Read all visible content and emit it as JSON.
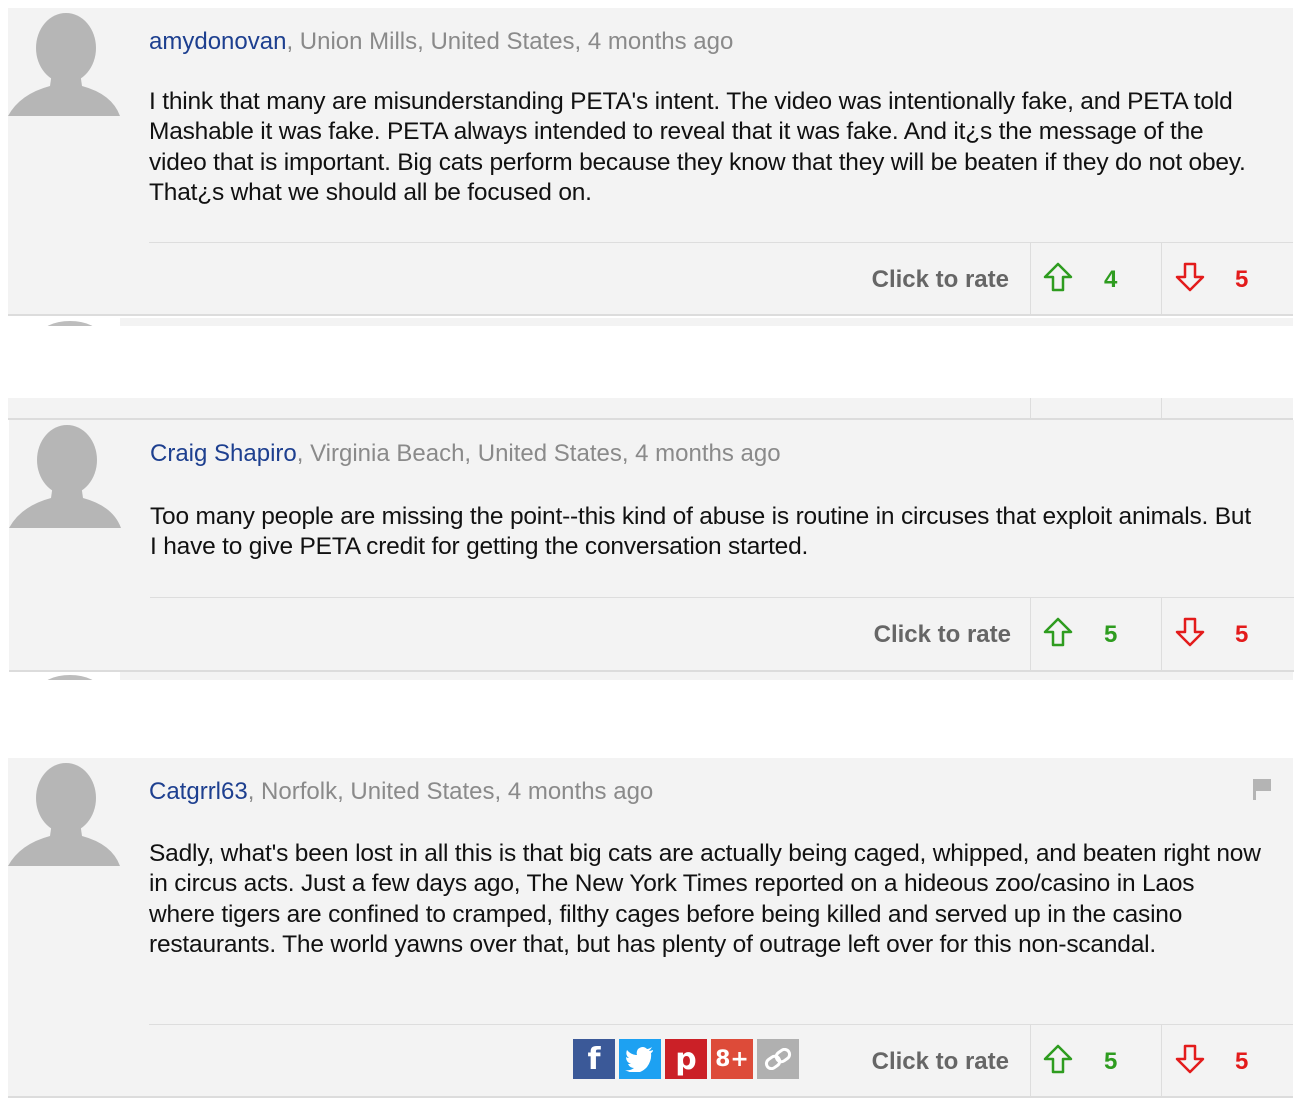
{
  "comments": [
    {
      "author": "amydonovan",
      "location_time": ", Union Mills, United States, 4 months ago",
      "text": "I think that many are misunderstanding PETA's intent. The video was intentionally fake, and PETA told Mashable it was fake. PETA always intended to reveal that it was fake. And it¿s the message of the video that is important. Big cats perform because they know that they will be beaten if they do not obey. That¿s what we should all be focused on.",
      "rate_label": "Click to rate",
      "up_votes": "4",
      "down_votes": "5"
    },
    {
      "author": "Craig Shapiro",
      "location_time": ", Virginia Beach, United States, 4 months ago",
      "text": "Too many people are missing the point--this kind of abuse is routine in circuses that exploit animals. But I have to give PETA credit for getting the conversation started.",
      "rate_label": "Click to rate",
      "up_votes": "5",
      "down_votes": "5"
    },
    {
      "author": "Catgrrl63",
      "location_time": ", Norfolk, United States, 4 months ago",
      "text": "Sadly, what's been lost in all this is that big cats are actually being caged, whipped, and beaten right now in circus acts. Just a few days ago, The New York Times reported on a hideous zoo/casino in Laos where tigers are confined to cramped, filthy cages before being killed and served up in the casino restaurants. The world yawns over that, but has plenty of outrage left over for this non-scandal.",
      "rate_label": "Click to rate",
      "up_votes": "5",
      "down_votes": "5"
    }
  ],
  "share": [
    {
      "icon": "facebook-icon",
      "glyph": "f",
      "color": "#3b5998"
    },
    {
      "icon": "twitter-icon",
      "glyph": "t",
      "color": "#1da1f2"
    },
    {
      "icon": "pinterest-icon",
      "glyph": "p",
      "color": "#cb2027"
    },
    {
      "icon": "google-plus-icon",
      "glyph": "8+",
      "color": "#dd4b39"
    },
    {
      "icon": "link-icon",
      "glyph": "∞",
      "color": "#b0b0b0"
    }
  ],
  "colors": {
    "author": "#1d3f8f",
    "meta": "#8a8a8a",
    "up": "#2e9c1f",
    "down": "#e31b1b",
    "card_bg": "#f3f3f3"
  }
}
